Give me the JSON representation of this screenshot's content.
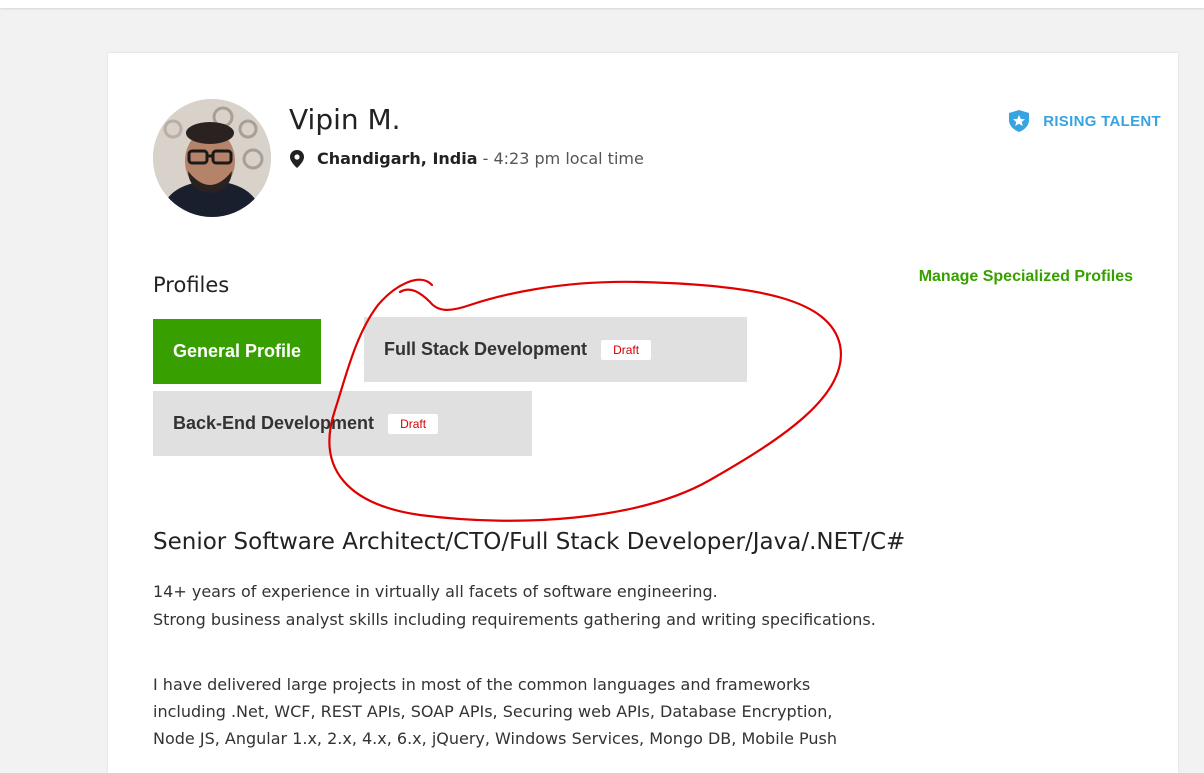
{
  "header": {
    "name": "Vipin M.",
    "location_city": "Chandigarh, India",
    "location_separator": " - ",
    "local_time": "4:23 pm local time",
    "badge_label": "RISING TALENT"
  },
  "profiles": {
    "heading": "Profiles",
    "manage_link": "Manage Specialized Profiles",
    "items": [
      {
        "label": "General Profile",
        "status": ""
      },
      {
        "label": "Full Stack Development",
        "status": "Draft"
      },
      {
        "label": "Back-End Development",
        "status": "Draft"
      }
    ]
  },
  "overview": {
    "title": "Senior Software Architect/CTO/Full Stack Developer/Java/.NET/C#",
    "lines": [
      "14+ years of experience in virtually all facets of software engineering.",
      "Strong business analyst skills including requirements gathering and writing specifications.",
      "I have delivered large projects in most of the common languages and frameworks",
      "including .Net, WCF, REST APIs, SOAP APIs, Securing web APIs, Database Encryption,",
      "Node JS, Angular 1.x, 2.x, 4.x, 6.x, jQuery, Windows Services, Mongo DB, Mobile Push"
    ]
  },
  "colors": {
    "brand_green": "#37a000",
    "rising_blue": "#37a3e0",
    "draft_red": "#d80000",
    "annotation_red": "#e00000"
  }
}
